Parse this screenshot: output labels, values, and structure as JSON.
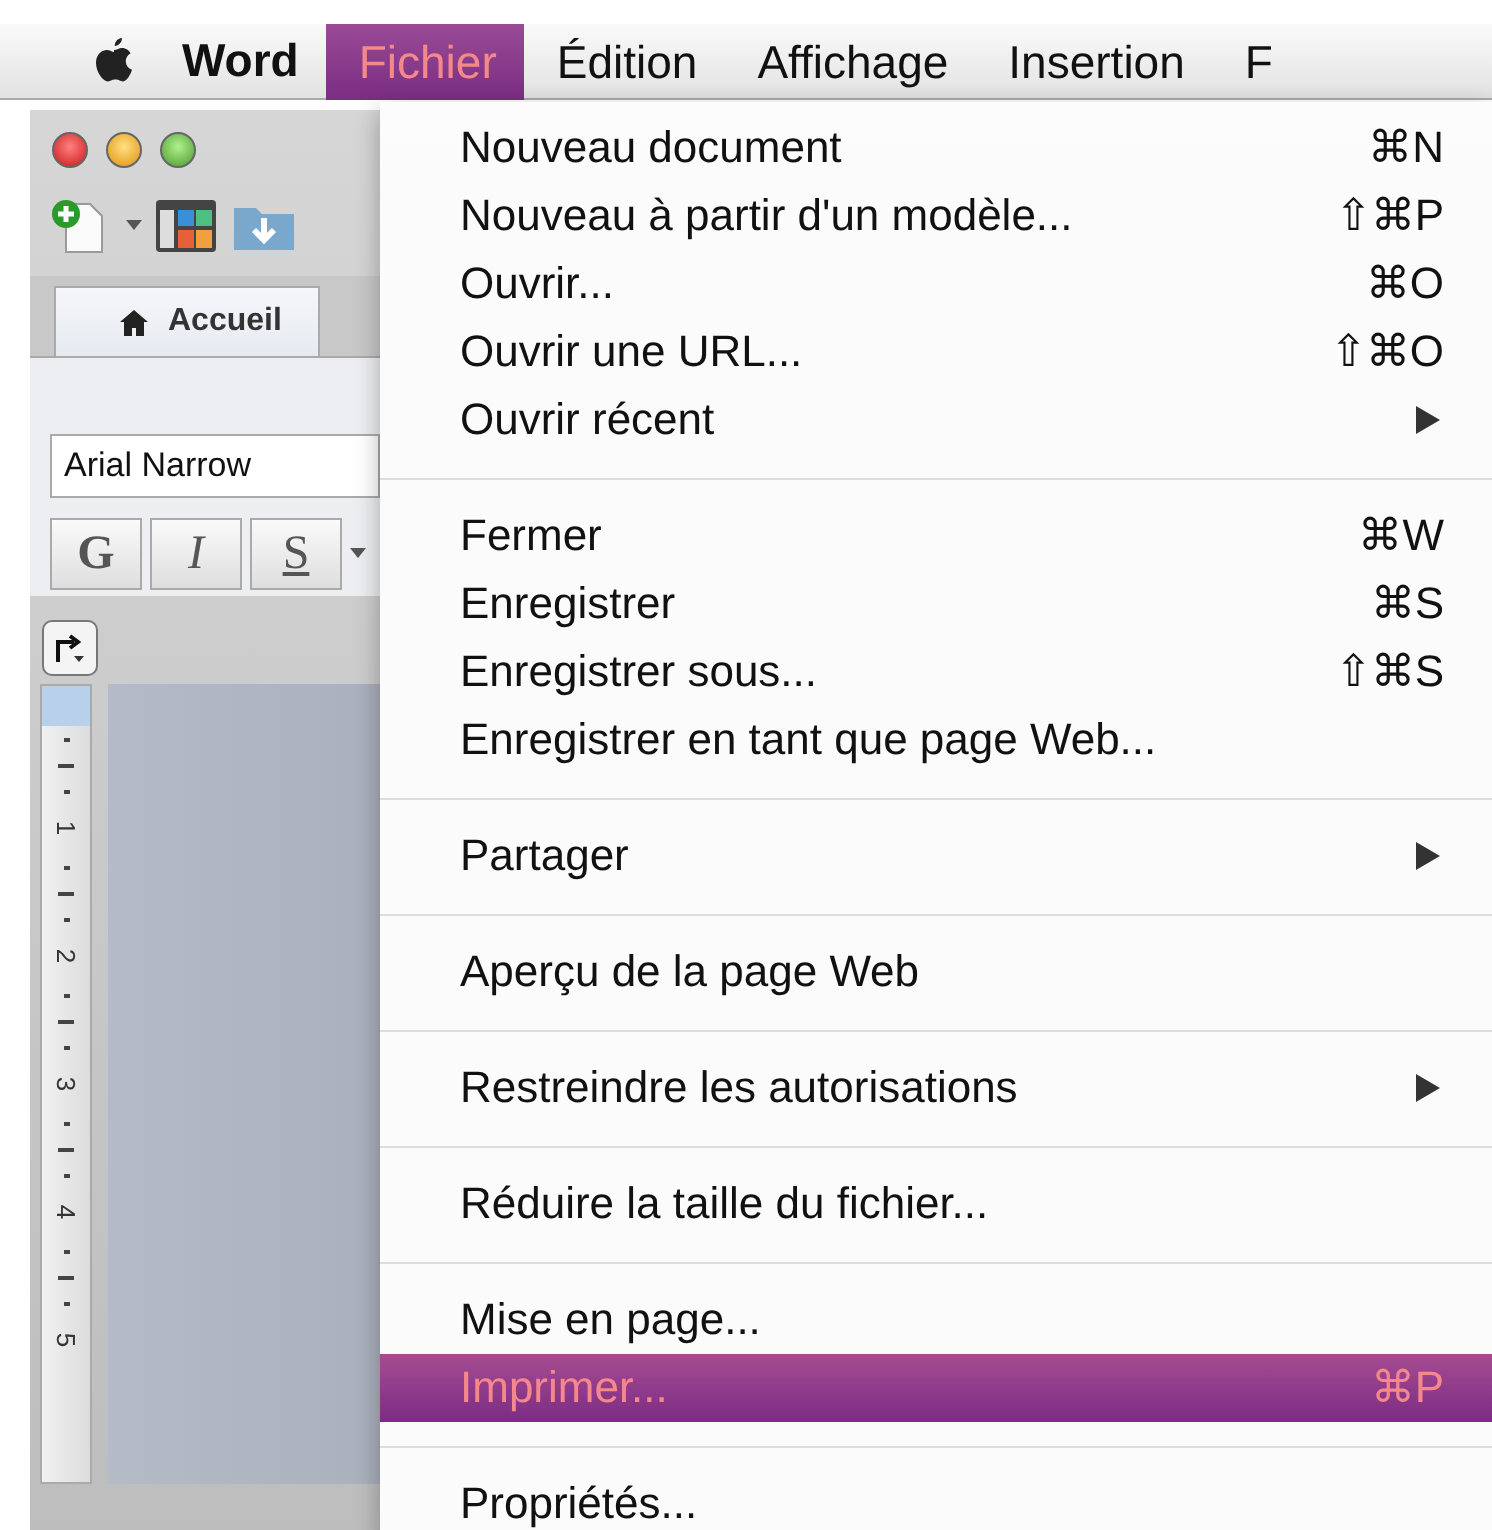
{
  "menubar": {
    "app": "Word",
    "items": [
      {
        "label": "Fichier",
        "selected": true
      },
      {
        "label": "Édition",
        "selected": false
      },
      {
        "label": "Affichage",
        "selected": false
      },
      {
        "label": "Insertion",
        "selected": false
      },
      {
        "label": "F",
        "selected": false
      }
    ]
  },
  "window": {
    "tab": {
      "label": "Accueil"
    },
    "font_field": {
      "value": "Arial Narrow"
    },
    "format_buttons": [
      {
        "label": "G"
      },
      {
        "label": "I"
      },
      {
        "label": "S"
      }
    ],
    "ruler": [
      "1",
      "2",
      "3",
      "4",
      "5"
    ]
  },
  "menu": {
    "sections": [
      [
        {
          "label": "Nouveau document",
          "shortcut": "⌘N",
          "submenu": false,
          "selected": false
        },
        {
          "label": "Nouveau à partir d'un modèle...",
          "shortcut": "⇧⌘P",
          "submenu": false,
          "selected": false
        },
        {
          "label": "Ouvrir...",
          "shortcut": "⌘O",
          "submenu": false,
          "selected": false
        },
        {
          "label": "Ouvrir une URL...",
          "shortcut": "⇧⌘O",
          "submenu": false,
          "selected": false
        },
        {
          "label": "Ouvrir récent",
          "submenu": true,
          "selected": false
        }
      ],
      [
        {
          "label": "Fermer",
          "shortcut": "⌘W",
          "submenu": false,
          "selected": false
        },
        {
          "label": "Enregistrer",
          "shortcut": "⌘S",
          "submenu": false,
          "selected": false
        },
        {
          "label": "Enregistrer sous...",
          "shortcut": "⇧⌘S",
          "submenu": false,
          "selected": false
        },
        {
          "label": "Enregistrer en tant que page Web...",
          "submenu": false,
          "selected": false
        }
      ],
      [
        {
          "label": "Partager",
          "submenu": true,
          "selected": false
        }
      ],
      [
        {
          "label": "Aperçu de la page Web",
          "submenu": false,
          "selected": false
        }
      ],
      [
        {
          "label": "Restreindre les autorisations",
          "submenu": true,
          "selected": false
        }
      ],
      [
        {
          "label": "Réduire la taille du fichier...",
          "submenu": false,
          "selected": false
        }
      ],
      [
        {
          "label": "Mise en page...",
          "submenu": false,
          "selected": false
        },
        {
          "label": "Imprimer...",
          "shortcut": "⌘P",
          "submenu": false,
          "selected": true
        }
      ],
      [
        {
          "label": "Propriétés...",
          "submenu": false,
          "selected": false
        }
      ]
    ]
  }
}
